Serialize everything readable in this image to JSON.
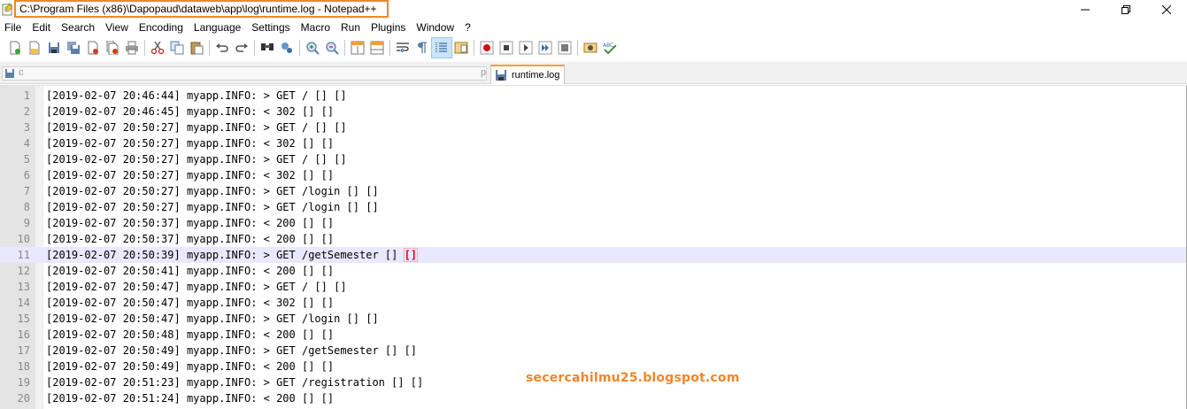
{
  "window": {
    "title": "C:\\Program Files (x86)\\Dapopaud\\dataweb\\app\\log\\runtime.log - Notepad++",
    "controls": [
      "minimize",
      "maximize",
      "close"
    ]
  },
  "menu": [
    "File",
    "Edit",
    "Search",
    "View",
    "Encoding",
    "Language",
    "Settings",
    "Macro",
    "Run",
    "Plugins",
    "Window",
    "?"
  ],
  "toolbar": {
    "icons": [
      "new-file-icon",
      "open-file-icon",
      "save-icon",
      "save-all-icon",
      "close-icon",
      "close-all-icon",
      "print-icon",
      "cut-icon",
      "copy-icon",
      "paste-icon",
      "undo-icon",
      "redo-icon",
      "find-icon",
      "replace-icon",
      "zoom-in-icon",
      "zoom-out-icon",
      "sync-vertical-icon",
      "sync-horizontal-icon",
      "word-wrap-icon",
      "show-all-chars-icon",
      "indent-guide-icon",
      "document-map-icon",
      "record-macro-icon",
      "stop-record-icon",
      "play-macro-icon",
      "run-macro-multiple-icon",
      "save-macro-icon",
      "launch-browser-icon",
      "spell-check-icon"
    ],
    "active_icon": "indent-guide-icon"
  },
  "tabs": {
    "other_tab_prefix": "c",
    "other_tab_suffix": "p",
    "active_label": "runtime.log"
  },
  "editor": {
    "current_line": 11,
    "lines": [
      "[2019-02-07 20:46:44] myapp.INFO: > GET / [] []",
      "[2019-02-07 20:46:45] myapp.INFO: < 302 [] []",
      "[2019-02-07 20:50:27] myapp.INFO: > GET / [] []",
      "[2019-02-07 20:50:27] myapp.INFO: < 302 [] []",
      "[2019-02-07 20:50:27] myapp.INFO: > GET / [] []",
      "[2019-02-07 20:50:27] myapp.INFO: < 302 [] []",
      "[2019-02-07 20:50:27] myapp.INFO: > GET /login [] []",
      "[2019-02-07 20:50:27] myapp.INFO: > GET /login [] []",
      "[2019-02-07 20:50:37] myapp.INFO: < 200 [] []",
      "[2019-02-07 20:50:37] myapp.INFO: < 200 [] []",
      "[2019-02-07 20:50:39] myapp.INFO: > GET /getSemester [] []",
      "[2019-02-07 20:50:41] myapp.INFO: < 200 [] []",
      "[2019-02-07 20:50:47] myapp.INFO: > GET / [] []",
      "[2019-02-07 20:50:47] myapp.INFO: < 302 [] []",
      "[2019-02-07 20:50:47] myapp.INFO: > GET /login [] []",
      "[2019-02-07 20:50:48] myapp.INFO: < 200 [] []",
      "[2019-02-07 20:50:49] myapp.INFO: > GET /getSemester [] []",
      "[2019-02-07 20:50:49] myapp.INFO: < 200 [] []",
      "[2019-02-07 20:51:23] myapp.INFO: > GET /registration [] []",
      "[2019-02-07 20:51:24] myapp.INFO: < 200 [] []"
    ]
  },
  "watermark": "secercahilmu25.blogspot.com",
  "colors": {
    "title_highlight": "#f0862a",
    "current_line_bg": "#e8e8ff",
    "brace_match": "#e0001a",
    "watermark": "#f0862a",
    "tab_accent": "#f89f3a"
  }
}
